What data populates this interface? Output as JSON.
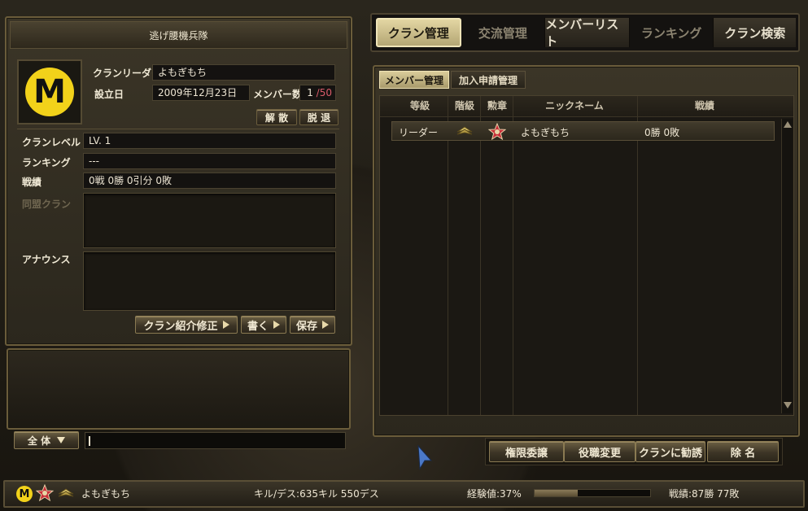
{
  "left_panel": {
    "title": "逃げ腰機兵隊",
    "labels": {
      "leader": "クランリーダー",
      "founded": "設立日",
      "members": "メンバー数",
      "level": "クランレベル",
      "ranking": "ランキング",
      "record": "戦績",
      "alliance": "同盟クラン",
      "announce": "アナウンス"
    },
    "values": {
      "leader": "よもぎもち",
      "founded": "2009年12月23日",
      "members_current": "1",
      "members_sep": "/",
      "members_max": "50",
      "level": "LV. 1",
      "ranking": "---",
      "record": "0戦 0勝 0引分 0敗"
    },
    "buttons": {
      "disband": "解 散",
      "leave": "脱 退",
      "edit_intro": "クラン紹介修正",
      "write": "書く",
      "save": "保存"
    },
    "logo_letter": "M"
  },
  "chat": {
    "channel": "全 体",
    "input_value": ""
  },
  "top_tabs": [
    "クラン管理",
    "交流管理",
    "メンバーリスト",
    "ランキング",
    "クラン検索"
  ],
  "sub_tabs": [
    "メンバー管理",
    "加入申請管理"
  ],
  "member_table": {
    "headers": [
      "等級",
      "階級",
      "勲章",
      "ニックネーム",
      "戦績"
    ],
    "rows": [
      {
        "grade": "リーダー",
        "rank_icon": "rank-chevron-icon",
        "medal_icon": "star-medal-icon",
        "nickname": "よもぎもち",
        "record": "0勝 0敗"
      }
    ]
  },
  "action_buttons": [
    "権限委譲",
    "役職変更",
    "クランに勧誘",
    "除 名"
  ],
  "status_bar": {
    "name": "よもぎもち",
    "kill_death": "キル/デス:635キル 550デス",
    "exp_label": "経験値:37%",
    "exp_fraction": 0.37,
    "record": "戦績:87勝 77敗"
  },
  "colors": {
    "logo_bg": "#f2d21a",
    "members_max": "#d95b6a",
    "active_tab": "#cdbf8e"
  }
}
